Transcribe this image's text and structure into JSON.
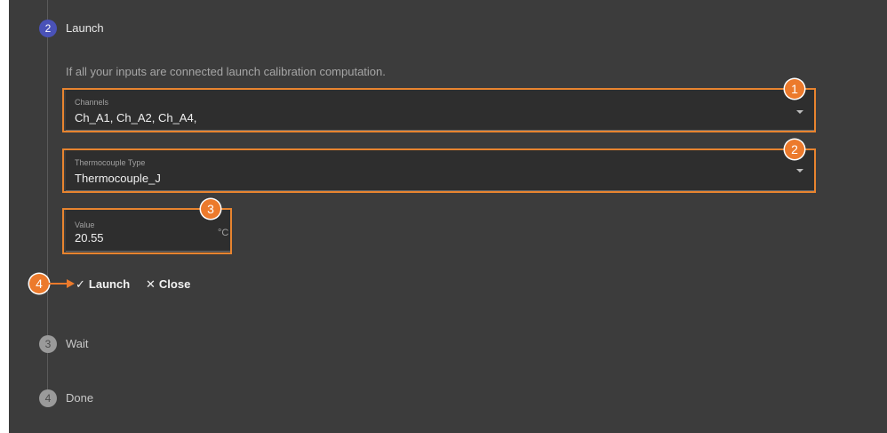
{
  "steps": [
    {
      "number": "2",
      "label": "Launch",
      "state": "active"
    },
    {
      "number": "3",
      "label": "Wait",
      "state": "pending"
    },
    {
      "number": "4",
      "label": "Done",
      "state": "pending"
    }
  ],
  "helper_text": "If all your inputs are connected launch calibration computation.",
  "fields": {
    "channels": {
      "label": "Channels",
      "value": "Ch_A1, Ch_A2, Ch_A4,"
    },
    "thermocouple": {
      "label": "Thermocouple Type",
      "value": "Thermocouple_J"
    },
    "value": {
      "label": "Value",
      "value": "20.55",
      "unit": "°C"
    }
  },
  "actions": {
    "launch": {
      "icon": "check-icon",
      "glyph": "✓",
      "label": "Launch"
    },
    "close": {
      "icon": "close-icon",
      "glyph": "✕",
      "label": "Close"
    }
  },
  "callouts": [
    "1",
    "2",
    "3",
    "4"
  ],
  "colors": {
    "background": "#3c3c3c",
    "active_step": "#4a52b8",
    "highlight": "#e8842f"
  }
}
